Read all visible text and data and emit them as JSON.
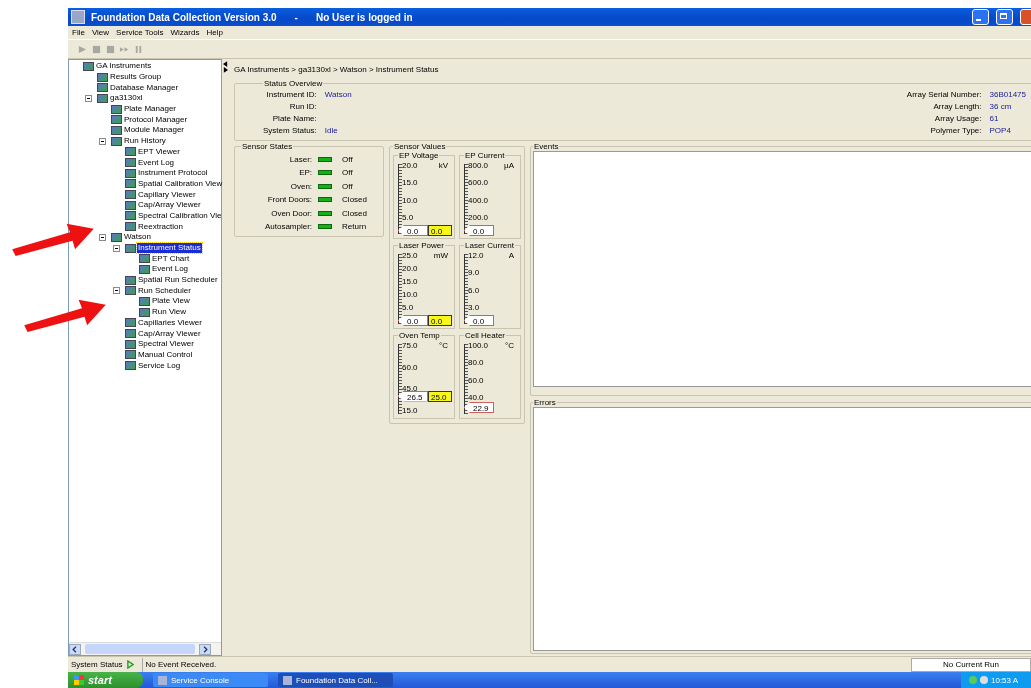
{
  "window": {
    "title": "Foundation Data Collection Version 3.0",
    "subtitle": "No User is logged in",
    "separator": "-"
  },
  "menu": [
    "File",
    "View",
    "Service Tools",
    "Wizards",
    "Help"
  ],
  "tree": [
    {
      "label": "GA Instruments",
      "selected": false,
      "expanded": true,
      "children": [
        {
          "label": "Results Group",
          "selected": false
        },
        {
          "label": "Database Manager",
          "selected": false
        },
        {
          "label": "ga3130xl",
          "selected": false,
          "expanded": true,
          "children": [
            {
              "label": "Plate Manager",
              "selected": false
            },
            {
              "label": "Protocol Manager",
              "selected": false
            },
            {
              "label": "Module Manager",
              "selected": false
            },
            {
              "label": "Run History",
              "selected": false,
              "expanded": true,
              "children": [
                {
                  "label": "EPT Viewer",
                  "selected": false
                },
                {
                  "label": "Event Log",
                  "selected": false
                },
                {
                  "label": "Instrument Protocol",
                  "selected": false
                },
                {
                  "label": "Spatial Calibration View",
                  "selected": false
                },
                {
                  "label": "Capillary Viewer",
                  "selected": false
                },
                {
                  "label": "Cap/Array Viewer",
                  "selected": false
                },
                {
                  "label": "Spectral Calibration Vie",
                  "selected": false
                },
                {
                  "label": "Reextraction",
                  "selected": false
                }
              ]
            },
            {
              "label": "Watson",
              "selected": false,
              "expanded": true,
              "children": [
                {
                  "label": "Instrument Status",
                  "selected": true,
                  "expanded": true,
                  "children": [
                    {
                      "label": "EPT Chart",
                      "selected": false
                    },
                    {
                      "label": "Event Log",
                      "selected": false
                    }
                  ]
                },
                {
                  "label": "Spatial Run Scheduler",
                  "selected": false
                },
                {
                  "label": "Run Scheduler",
                  "selected": false,
                  "expanded": true,
                  "children": [
                    {
                      "label": "Plate View",
                      "selected": false
                    },
                    {
                      "label": "Run View",
                      "selected": false
                    }
                  ]
                },
                {
                  "label": "Capillaries Viewer",
                  "selected": false
                },
                {
                  "label": "Cap/Array Viewer",
                  "selected": false
                },
                {
                  "label": "Spectral Viewer",
                  "selected": false
                },
                {
                  "label": "Manual Control",
                  "selected": false
                },
                {
                  "label": "Service Log",
                  "selected": false
                }
              ]
            }
          ]
        }
      ]
    }
  ],
  "breadcrumb": "GA Instruments > ga3130xl > Watson > Instrument Status",
  "status_overview": {
    "title": "Status Overview",
    "left": [
      {
        "label": "Instrument ID:",
        "value": "Watson"
      },
      {
        "label": "Run ID:"
      },
      {
        "label": "Plate Name:"
      },
      {
        "label": "System Status:",
        "value": "Idle"
      }
    ],
    "right": [
      {
        "label": "Array Serial Number:",
        "value": "36B01475"
      },
      {
        "label": "Array Length:",
        "value": "36  cm"
      },
      {
        "label": "Array Usage:",
        "value": "61"
      },
      {
        "label": "Polymer Type:",
        "value": "POP4"
      }
    ]
  },
  "sensor_states": {
    "title": "Sensor States",
    "rows": [
      {
        "label": "Laser:",
        "value": "Off"
      },
      {
        "label": "EP:",
        "value": "Off"
      },
      {
        "label": "Oven:",
        "value": "Off"
      },
      {
        "label": "Front Doors:",
        "value": "Closed"
      },
      {
        "label": "Oven Door:",
        "value": "Closed"
      },
      {
        "label": "Autosampler:",
        "value": "Return"
      }
    ]
  },
  "sensor_values": {
    "title": "Sensor Values",
    "gauges": [
      {
        "title": "EP Voltage",
        "unit": "kV",
        "ticks": [
          "20.0",
          "15.0",
          "10.0",
          "5.0"
        ],
        "reading": "0.0",
        "setpoint": "0.0",
        "level": 0
      },
      {
        "title": "EP Current",
        "unit": "µA",
        "ticks": [
          "800.0",
          "600.0",
          "400.0",
          "200.0"
        ],
        "reading": "0.0",
        "level": 0
      },
      {
        "title": "Laser Power",
        "unit": "mW",
        "ticks": [
          "25.0",
          "20.0",
          "15.0",
          "10.0",
          "5.0"
        ],
        "reading": "0.0",
        "setpoint": "0.0",
        "level": 0
      },
      {
        "title": "Laser Current",
        "unit": "A",
        "ticks": [
          "12.0",
          "9.0",
          "6.0",
          "3.0"
        ],
        "reading": "0.0",
        "level": 0
      },
      {
        "title": "Oven Temp",
        "unit": "°C",
        "ticks": [
          "75.0",
          "60.0",
          "45.0",
          "15.0"
        ],
        "reading": "26.5",
        "setpoint": "25.0",
        "level": 0.19
      },
      {
        "title": "Cell Heater",
        "unit": "°C",
        "ticks": [
          "100.0",
          "80.0",
          "60.0",
          "40.0"
        ],
        "reading": "22.9",
        "level": 0.04
      }
    ]
  },
  "events": {
    "title": "Events"
  },
  "errors": {
    "title": "Errors"
  },
  "status_bar": {
    "label": "System Status",
    "message": "No Event Received.",
    "run": "No Current Run"
  },
  "taskbar": {
    "start": "start",
    "tasks": [
      {
        "label": "Service Console",
        "selected": false
      },
      {
        "label": "Foundation Data Coll...",
        "selected": true
      }
    ],
    "clock": "10:53 A"
  }
}
